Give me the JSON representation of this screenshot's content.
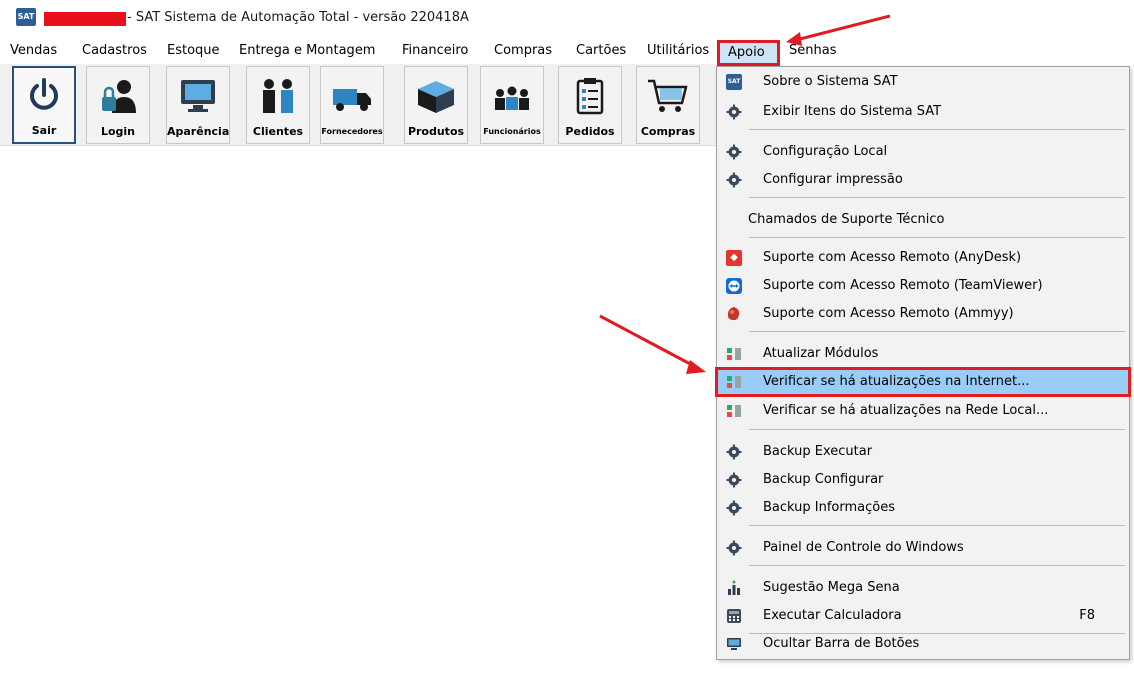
{
  "window": {
    "title": "- SAT Sistema de Automação Total - versão 220418A",
    "icon": "sat-logo-icon"
  },
  "menubar": {
    "items": [
      "Vendas",
      "Cadastros",
      "Estoque",
      "Entrega e Montagem",
      "Financeiro",
      "Compras",
      "Cartões",
      "Utilitários",
      "Apoio",
      "Senhas"
    ],
    "active": "Apoio"
  },
  "toolbar": {
    "buttons": [
      {
        "label": "Sair",
        "icon": "power-icon"
      },
      {
        "label": "Login",
        "icon": "user-lock-icon"
      },
      {
        "label": "Aparência",
        "icon": "monitor-icon"
      },
      {
        "label": "Clientes",
        "icon": "people-icon"
      },
      {
        "label": "Fornecedores",
        "icon": "truck-icon"
      },
      {
        "label": "Produtos",
        "icon": "box-icon"
      },
      {
        "label": "Funcionários",
        "icon": "team-icon"
      },
      {
        "label": "Pedidos",
        "icon": "clipboard-icon"
      },
      {
        "label": "Compras",
        "icon": "cart-icon"
      }
    ]
  },
  "dropdown": {
    "items": [
      {
        "label": "Sobre o Sistema SAT",
        "icon": "sat-logo-icon"
      },
      {
        "label": "Exibir Itens do Sistema SAT",
        "icon": "gear-icon"
      },
      {
        "label": "Configuração Local",
        "icon": "gear-icon"
      },
      {
        "label": "Configurar impressão",
        "icon": "gear-icon"
      },
      {
        "label": "Chamados de Suporte Técnico"
      },
      {
        "label": "Suporte com Acesso Remoto (AnyDesk)",
        "icon": "anydesk-icon"
      },
      {
        "label": "Suporte com Acesso Remoto (TeamViewer)",
        "icon": "teamviewer-icon"
      },
      {
        "label": "Suporte com Acesso Remoto (Ammyy)",
        "icon": "ammyy-icon"
      },
      {
        "label": "Atualizar Módulos",
        "icon": "update-icon"
      },
      {
        "label": "Verificar se há atualizações na Internet...",
        "icon": "update-icon",
        "highlighted": true
      },
      {
        "label": "Verificar se há atualizações na Rede Local...",
        "icon": "update-icon"
      },
      {
        "label": "Backup Executar",
        "icon": "gear-icon"
      },
      {
        "label": "Backup Configurar",
        "icon": "gear-icon"
      },
      {
        "label": "Backup Informações",
        "icon": "gear-icon"
      },
      {
        "label": "Painel de Controle do Windows",
        "icon": "gear-icon"
      },
      {
        "label": "Sugestão Mega Sena",
        "icon": "chart-icon"
      },
      {
        "label": "Executar Calculadora",
        "icon": "calculator-icon",
        "shortcut": "F8"
      },
      {
        "label": "Ocultar Barra de Botões",
        "icon": "monitor-icon"
      }
    ]
  },
  "colors": {
    "highlight_border": "#e11b22",
    "selection": "#99ccf7",
    "redaction": "#e8101a"
  }
}
